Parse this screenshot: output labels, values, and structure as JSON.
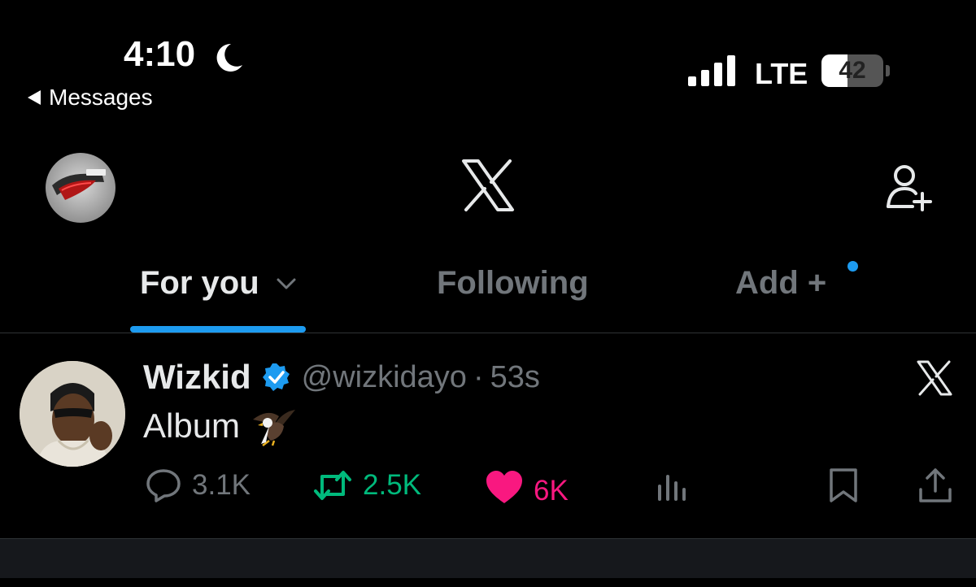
{
  "status_bar": {
    "time": "4:10",
    "back_label": "Messages",
    "network": "LTE",
    "battery": "42",
    "battery_level": 0.42
  },
  "header": {
    "logo": "x-logo-icon"
  },
  "tabs": [
    {
      "label": "For you",
      "active": true
    },
    {
      "label": "Following",
      "active": false
    },
    {
      "label": "Add +",
      "active": false
    }
  ],
  "post": {
    "name": "Wizkid",
    "handle": "@wizkidayo",
    "separator": "·",
    "time_ago": "53s",
    "text": "Album",
    "emoji": "eagle",
    "replies": "3.1K",
    "reposts": "2.5K",
    "likes": "6K"
  },
  "colors": {
    "accent": "#1d9bf0",
    "repost": "#00ba7c",
    "like": "#f91880",
    "muted": "#71767b"
  }
}
